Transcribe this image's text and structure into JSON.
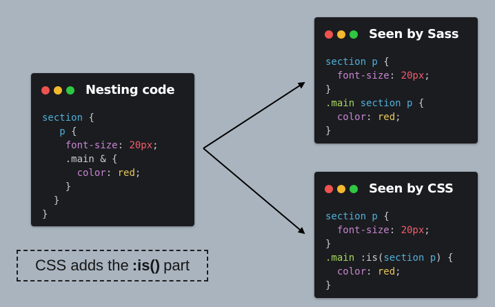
{
  "windows": {
    "nesting": {
      "title": "Nesting code",
      "lines": [
        [
          {
            "t": "section",
            "c": "sel"
          },
          {
            "t": " {",
            "c": "p"
          }
        ],
        [
          {
            "t": "   ",
            "c": "p"
          },
          {
            "t": "p",
            "c": "sel"
          },
          {
            "t": " {",
            "c": "p"
          }
        ],
        [
          {
            "t": "    ",
            "c": "p"
          },
          {
            "t": "font-size",
            "c": "prop"
          },
          {
            "t": ": ",
            "c": "p"
          },
          {
            "t": "20px",
            "c": "num"
          },
          {
            "t": ";",
            "c": "p"
          }
        ],
        [
          {
            "t": "    .main & {",
            "c": "p"
          }
        ],
        [
          {
            "t": "      ",
            "c": "p"
          },
          {
            "t": "color",
            "c": "prop"
          },
          {
            "t": ": ",
            "c": "p"
          },
          {
            "t": "red",
            "c": "val"
          },
          {
            "t": ";",
            "c": "p"
          }
        ],
        [
          {
            "t": "    }",
            "c": "p"
          }
        ],
        [
          {
            "t": "  }",
            "c": "p"
          }
        ],
        [
          {
            "t": "}",
            "c": "p"
          }
        ]
      ]
    },
    "sass": {
      "title": "Seen by Sass",
      "lines": [
        [
          {
            "t": "section p",
            "c": "sel"
          },
          {
            "t": " {",
            "c": "p"
          }
        ],
        [
          {
            "t": "  ",
            "c": "p"
          },
          {
            "t": "font-size",
            "c": "prop"
          },
          {
            "t": ": ",
            "c": "p"
          },
          {
            "t": "20px",
            "c": "num"
          },
          {
            "t": ";",
            "c": "p"
          }
        ],
        [
          {
            "t": "}",
            "c": "p"
          }
        ],
        [
          {
            "t": ".main",
            "c": "cls"
          },
          {
            "t": " ",
            "c": "p"
          },
          {
            "t": "section p",
            "c": "sel"
          },
          {
            "t": " {",
            "c": "p"
          }
        ],
        [
          {
            "t": "  ",
            "c": "p"
          },
          {
            "t": "color",
            "c": "prop"
          },
          {
            "t": ": ",
            "c": "p"
          },
          {
            "t": "red",
            "c": "val"
          },
          {
            "t": ";",
            "c": "p"
          }
        ],
        [
          {
            "t": "}",
            "c": "p"
          }
        ]
      ]
    },
    "css": {
      "title": "Seen by CSS",
      "lines": [
        [
          {
            "t": "section p",
            "c": "sel"
          },
          {
            "t": " {",
            "c": "p"
          }
        ],
        [
          {
            "t": "  ",
            "c": "p"
          },
          {
            "t": "font-size",
            "c": "prop"
          },
          {
            "t": ": ",
            "c": "p"
          },
          {
            "t": "20px",
            "c": "num"
          },
          {
            "t": ";",
            "c": "p"
          }
        ],
        [
          {
            "t": "}",
            "c": "p"
          }
        ],
        [
          {
            "t": ".main",
            "c": "cls"
          },
          {
            "t": " :is(",
            "c": "p"
          },
          {
            "t": "section p",
            "c": "sel"
          },
          {
            "t": ") {",
            "c": "p"
          }
        ],
        [
          {
            "t": "  ",
            "c": "p"
          },
          {
            "t": "color",
            "c": "prop"
          },
          {
            "t": ": ",
            "c": "p"
          },
          {
            "t": "red",
            "c": "val"
          },
          {
            "t": ";",
            "c": "p"
          }
        ],
        [
          {
            "t": "}",
            "c": "p"
          }
        ]
      ]
    }
  },
  "note": {
    "before": "CSS adds the",
    "highlight": ":is()",
    "after": "part"
  },
  "colors": {
    "background": "#a9b4bf",
    "window": "#1b1c20",
    "dot_red": "#ee5350",
    "dot_yellow": "#f4b82e",
    "dot_green": "#2fc842",
    "selector": "#4fb0d8",
    "class": "#a7d75e",
    "property": "#c685d0",
    "number": "#f25c6c",
    "value": "#e8c75c"
  }
}
